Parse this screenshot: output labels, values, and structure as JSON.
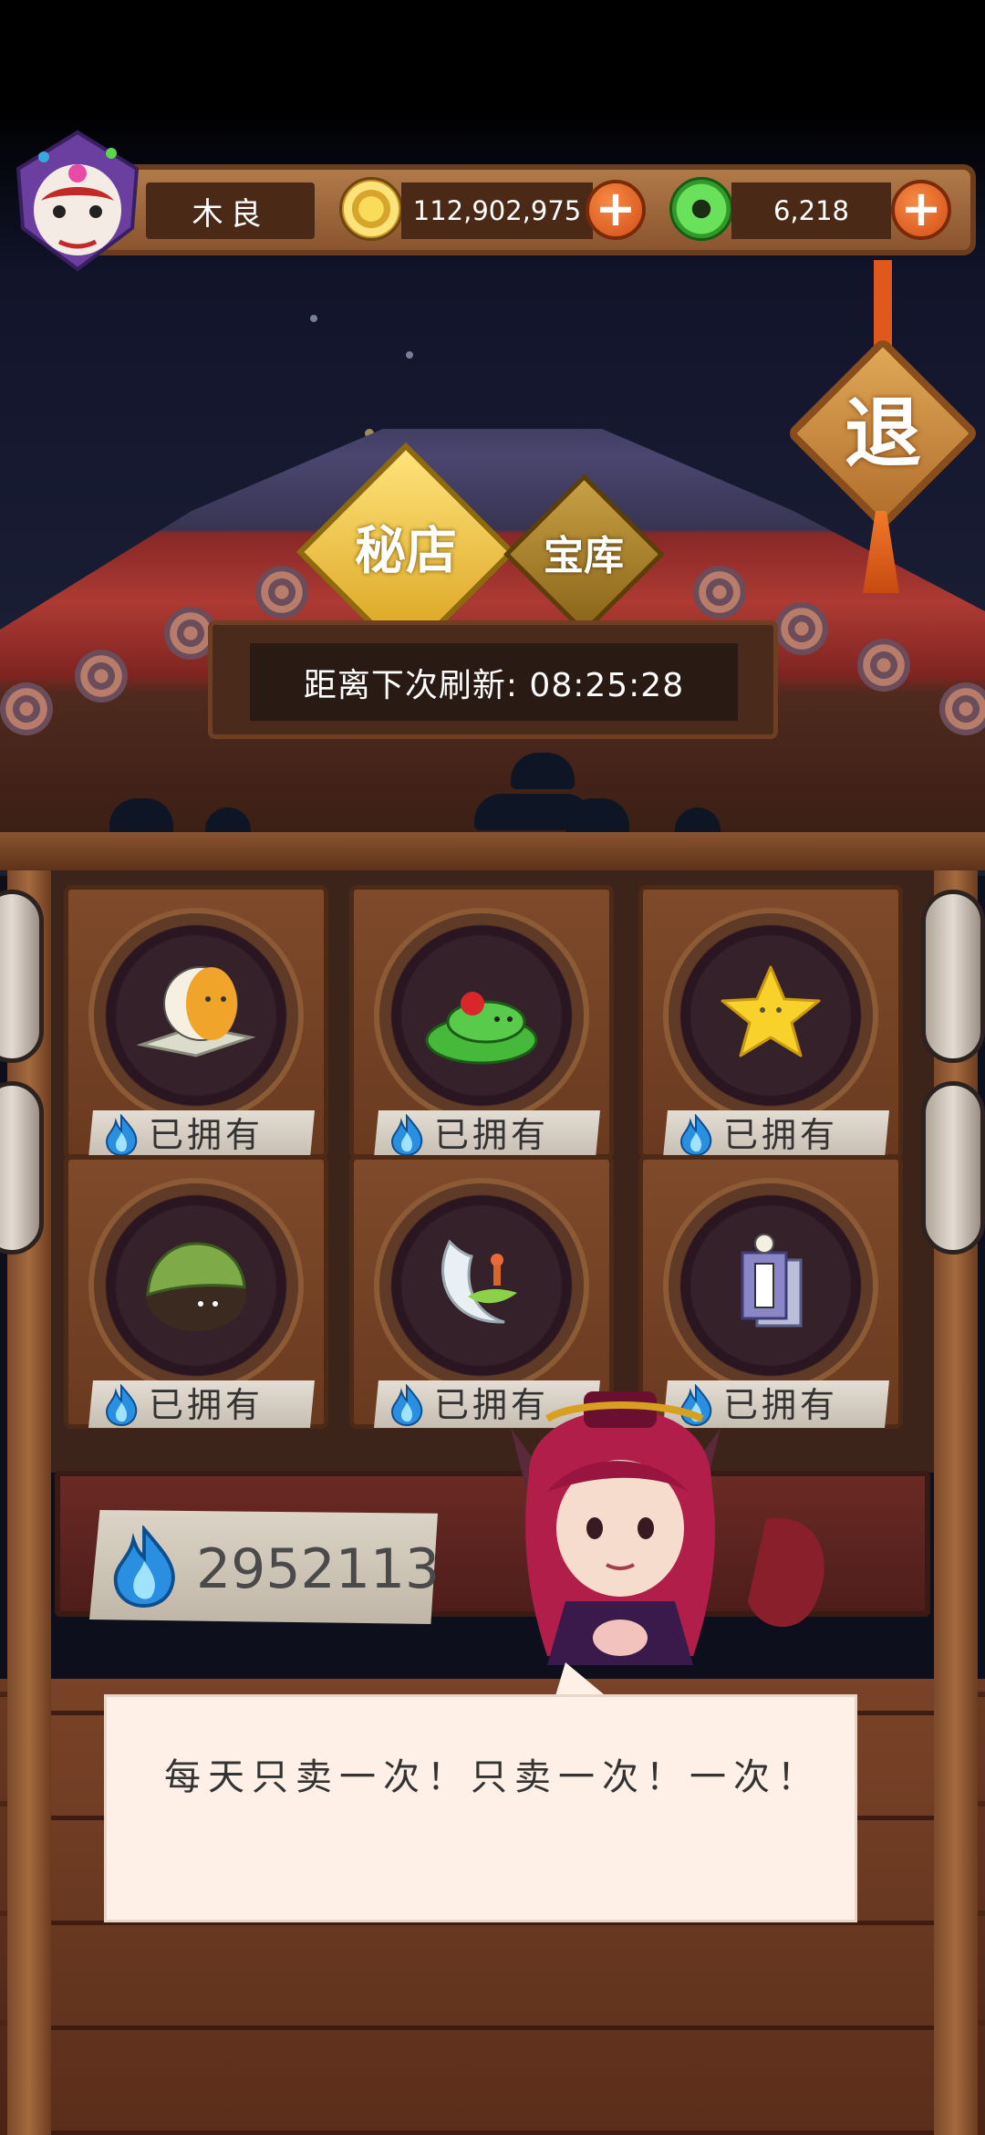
{
  "header": {
    "player_name": "木良",
    "coins": "112,902,975",
    "jade": "6,218",
    "add_symbol": "+"
  },
  "exit_button": {
    "label": "退"
  },
  "tabs": [
    {
      "label": "秘店",
      "active": true
    },
    {
      "label": "宝库",
      "active": false
    }
  ],
  "refresh_timer": "距离下次刷新: 08:25:28",
  "items": [
    {
      "icon": "mask-on-cushion-icon",
      "status": "已拥有"
    },
    {
      "icon": "green-snake-icon",
      "status": "已拥有"
    },
    {
      "icon": "yellow-star-icon",
      "status": "已拥有"
    },
    {
      "icon": "turtle-shell-icon",
      "status": "已拥有"
    },
    {
      "icon": "crescent-moon-icon",
      "status": "已拥有"
    },
    {
      "icon": "talisman-cards-icon",
      "status": "已拥有"
    }
  ],
  "soul_fire_balance": "2952113",
  "dialog": {
    "text": "每天只卖一次！只卖一次！一次！"
  },
  "colors": {
    "wood": "#8a5530",
    "plus_button": "#d24e16",
    "gold": "#f1c232",
    "soul_flame": "#2a8fe0",
    "dialog_bg": "#fef0e6"
  }
}
